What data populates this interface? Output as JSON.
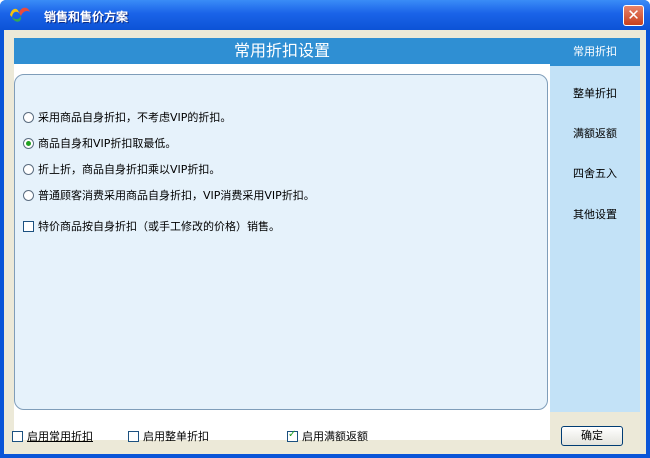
{
  "window": {
    "title": "销售和售价方案",
    "close_label": "✕"
  },
  "sidebar": {
    "items": [
      {
        "label": "常用折扣",
        "active": true
      },
      {
        "label": "整单折扣",
        "active": false
      },
      {
        "label": "满额返额",
        "active": false
      },
      {
        "label": "四舍五入",
        "active": false
      },
      {
        "label": "其他设置",
        "active": false
      }
    ]
  },
  "panel": {
    "header": "常用折扣设置",
    "options": [
      {
        "label": "采用商品自身折扣，不考虑VIP的折扣。",
        "checked": false
      },
      {
        "label": "商品自身和VIP折扣取最低。",
        "checked": true
      },
      {
        "label": "折上折，商品自身折扣乘以VIP折扣。",
        "checked": false
      },
      {
        "label": "普通顾客消费采用商品自身折扣，VIP消费采用VIP折扣。",
        "checked": false
      }
    ],
    "special_check": {
      "label": "特价商品按自身折扣（或手工修改的价格）销售。",
      "checked": false
    }
  },
  "bottom": {
    "enable_common": {
      "label": "启用常用折扣",
      "checked": false
    },
    "enable_whole": {
      "label": "启用整单折扣",
      "checked": false
    },
    "enable_return": {
      "label": "启用满额返额",
      "checked": true
    },
    "ok_label": "确定"
  }
}
